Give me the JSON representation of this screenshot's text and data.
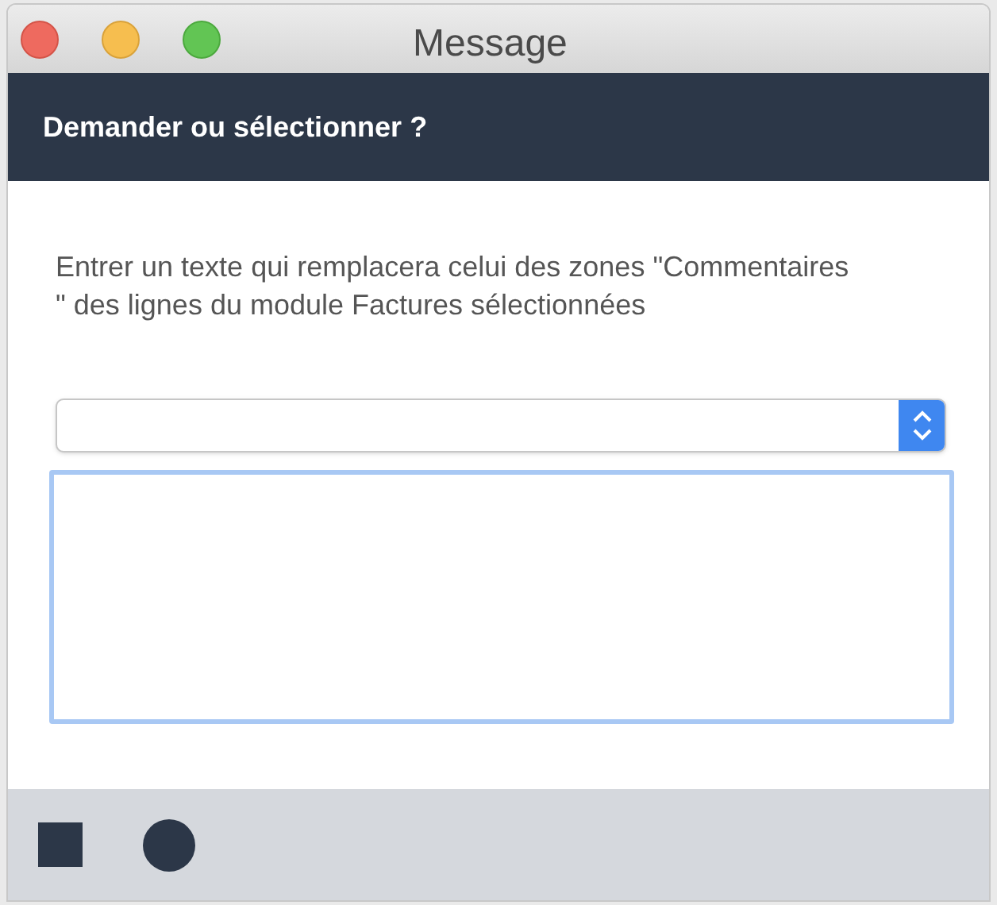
{
  "window": {
    "title": "Message"
  },
  "header": {
    "title": "Demander ou sélectionner ?"
  },
  "prompt": "Entrer un texte qui remplacera celui des zones \"Commentaires   \" des lignes du module Factures sélectionnées",
  "footer": {
    "buttons": [
      {
        "kind": "square"
      },
      {
        "kind": "circle"
      }
    ]
  }
}
